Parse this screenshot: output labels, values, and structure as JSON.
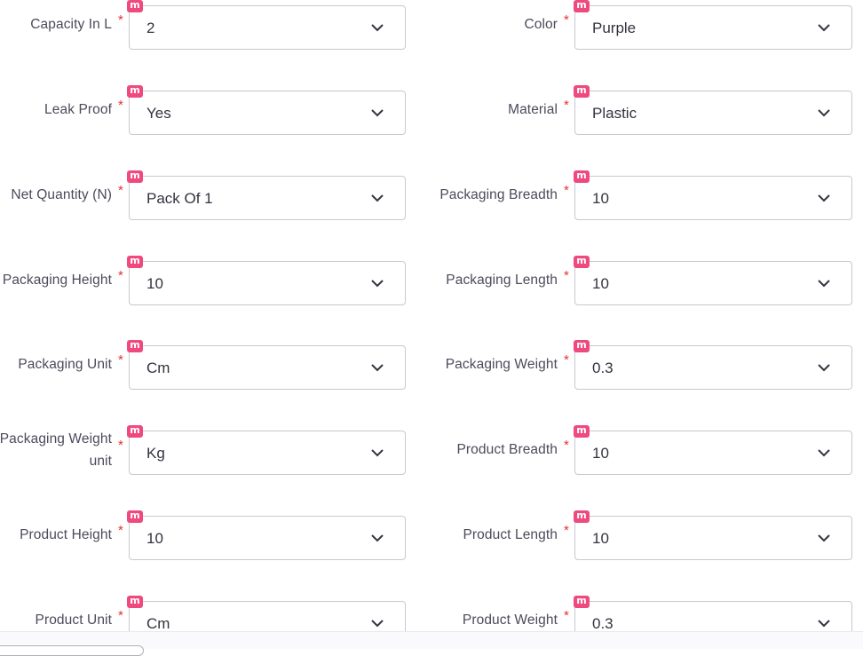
{
  "fields": [
    {
      "label": "Capacity In L",
      "value": "2"
    },
    {
      "label": "Color",
      "value": "Purple"
    },
    {
      "label": "Leak Proof",
      "value": "Yes"
    },
    {
      "label": "Material",
      "value": "Plastic"
    },
    {
      "label": "Net Quantity (N)",
      "value": "Pack Of 1"
    },
    {
      "label": "Packaging Breadth",
      "value": "10"
    },
    {
      "label": "Packaging Height",
      "value": "10"
    },
    {
      "label": "Packaging Length",
      "value": "10"
    },
    {
      "label": "Packaging Unit",
      "value": "Cm"
    },
    {
      "label": "Packaging Weight",
      "value": "0.3"
    },
    {
      "label": "Packaging Weight unit",
      "value": "Kg"
    },
    {
      "label": "Product Breadth",
      "value": "10"
    },
    {
      "label": "Product Height",
      "value": "10"
    },
    {
      "label": "Product Length",
      "value": "10"
    },
    {
      "label": "Product Unit",
      "value": "Cm"
    },
    {
      "label": "Product Weight",
      "value": "0.3"
    }
  ],
  "required_mark": "*",
  "badge_text": "m",
  "icons": {
    "dropdown": "chevron-down-icon"
  },
  "colors": {
    "required": "#e5322d",
    "badge": "#ef4a7f",
    "border": "#c8c8d0",
    "label": "#4b4b5c"
  }
}
